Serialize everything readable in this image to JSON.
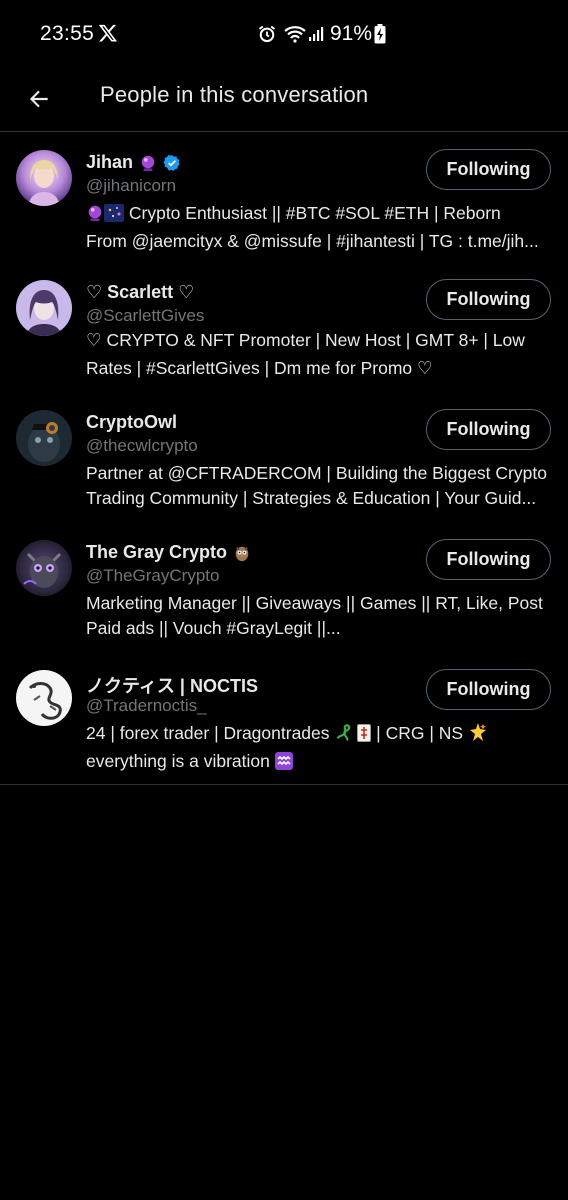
{
  "status_bar": {
    "time": "23:55",
    "battery": "91%"
  },
  "header": {
    "title": "People in this conversation"
  },
  "colors": {
    "background": "#000000",
    "text_primary": "#e7e9ea",
    "text_secondary": "#71767b",
    "verified_blue": "#1d9bf0",
    "border": "#2f3336"
  },
  "people": [
    {
      "name": "Jihan",
      "handle": "@jihanicorn",
      "bio_line1": "Crypto Enthusiast || #BTC #SOL #ETH | Reborn",
      "bio_line2": "From @jaemcityx & @missufe | #jihantesti | TG : t.me/jih...",
      "button": "Following",
      "verified": true
    },
    {
      "name": "♡ Scarlett ♡",
      "handle": "@ScarlettGives",
      "bio_line1": "♡ CRYPTO & NFT Promoter | New Host | GMT 8+ | Low",
      "bio_line2": "Rates | #ScarlettGives | Dm me for Promo ♡",
      "button": "Following"
    },
    {
      "name": "CryptoOwl",
      "handle": "@thecwlcrypto",
      "bio_line1": "Partner at @CFTRADERCOM | Building the Biggest Crypto",
      "bio_line2": "Trading Community | Strategies & Education | Your Guid...",
      "button": "Following"
    },
    {
      "name": "The Gray Crypto",
      "handle": "@TheGrayCrypto",
      "bio_line1": "Marketing Manager || Giveaways || Games || RT, Like, Post",
      "bio_line2": "Paid ads || Vouch #GrayLegit ||...",
      "button": "Following"
    },
    {
      "name": "ノクティス | NOCTIS",
      "handle": "@Tradernoctis_",
      "bio_line1a": "24 | forex trader | Dragontrades",
      "bio_line1b": "| CRG | NS",
      "bio_line2": "everything is a vibration",
      "button": "Following"
    }
  ]
}
